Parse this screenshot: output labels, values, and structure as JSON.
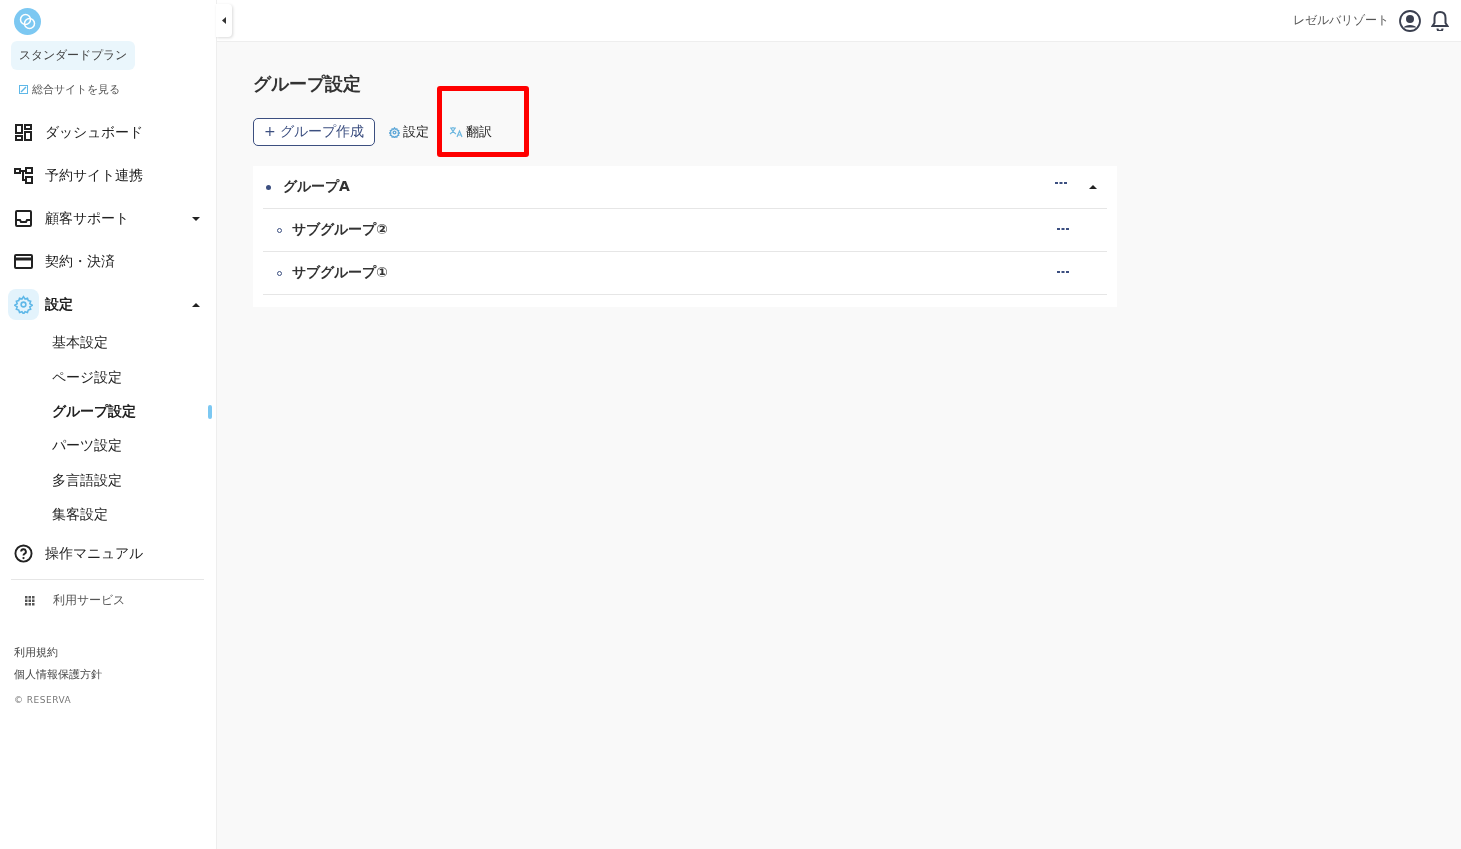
{
  "sidebar": {
    "plan": "スタンダードプラン",
    "site_link": "総合サイトを見る",
    "nav": [
      {
        "kind": "dashboard",
        "label": "ダッシュボード",
        "selected": false
      },
      {
        "kind": "link",
        "label": "予約サイト連携",
        "selected": false
      },
      {
        "kind": "inbox",
        "label": "顧客サポート",
        "selected": false,
        "expanded": false
      },
      {
        "kind": "card",
        "label": "契約・決済",
        "selected": false
      },
      {
        "kind": "gear",
        "label": "設定",
        "selected": true,
        "expanded": true,
        "children": [
          {
            "label": "基本設定",
            "selected": false
          },
          {
            "label": "ページ設定",
            "selected": false
          },
          {
            "label": "グループ設定",
            "selected": true
          },
          {
            "label": "パーツ設定",
            "selected": false
          },
          {
            "label": "多言語設定",
            "selected": false
          },
          {
            "label": "集客設定",
            "selected": false
          }
        ]
      },
      {
        "kind": "help",
        "label": "操作マニュアル",
        "selected": false
      }
    ],
    "services": "利用サービス",
    "footer_links": [
      "利用規約",
      "個人情報保護方針"
    ],
    "copyright": "© RESERVA"
  },
  "header": {
    "account": "レゼルバリゾート"
  },
  "page": {
    "title": "グループ設定",
    "create_button": "+ グループ作成",
    "toolbar": [
      {
        "kind": "gear",
        "label": "設定",
        "highlighted": false
      },
      {
        "kind": "translate",
        "label": "翻訳",
        "highlighted": true
      }
    ],
    "groups": [
      {
        "name": "グループA",
        "expanded": true,
        "children": [
          {
            "name": "サブグループ②"
          },
          {
            "name": "サブグループ①"
          }
        ]
      }
    ]
  }
}
